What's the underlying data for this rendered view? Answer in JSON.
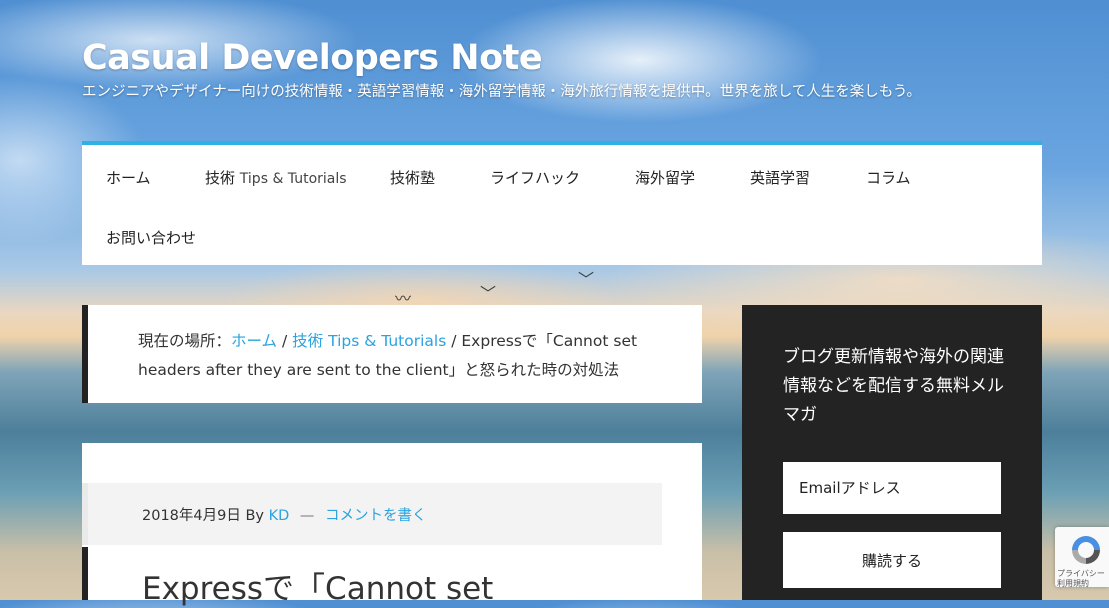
{
  "site": {
    "title": "Casual Developers Note",
    "tagline": "エンジニアやデザイナー向けの技術情報・英語学習情報・海外留学情報・海外旅行情報を提供中。世界を旅して人生を楽しもう。"
  },
  "nav": {
    "items": [
      {
        "label": "ホーム"
      },
      {
        "label": "技術",
        "sub": "Tips & Tutorials"
      },
      {
        "label": "技術塾"
      },
      {
        "label": "ライフハック"
      },
      {
        "label": "海外留学"
      },
      {
        "label": "英語学習"
      },
      {
        "label": "コラム"
      },
      {
        "label": "お問い合わせ"
      }
    ]
  },
  "breadcrumb": {
    "prefix": "現在の場所：",
    "home": "ホーム",
    "sep": " / ",
    "category": "技術",
    "category_sub": "Tips & Tutorials",
    "current": "Expressで「Cannot set headers after they are sent to the client」と怒られた時の対処法"
  },
  "article": {
    "date": "2018年4月9日",
    "by": "By",
    "author": "KD",
    "dash": "—",
    "comment_link": "コメントを書く",
    "title": "Expressで「Cannot set"
  },
  "sidebar": {
    "heading": "ブログ更新情報や海外の関連情報などを配信する無料メルマガ",
    "email_placeholder": "Emailアドレス",
    "subscribe_label": "購読する"
  },
  "recaptcha": {
    "line1": "プライバシー",
    "line2": "利用規約"
  },
  "colors": {
    "accent": "#2aa3df",
    "nav_border": "#2db2e6",
    "sidebar_bg": "#232323"
  }
}
